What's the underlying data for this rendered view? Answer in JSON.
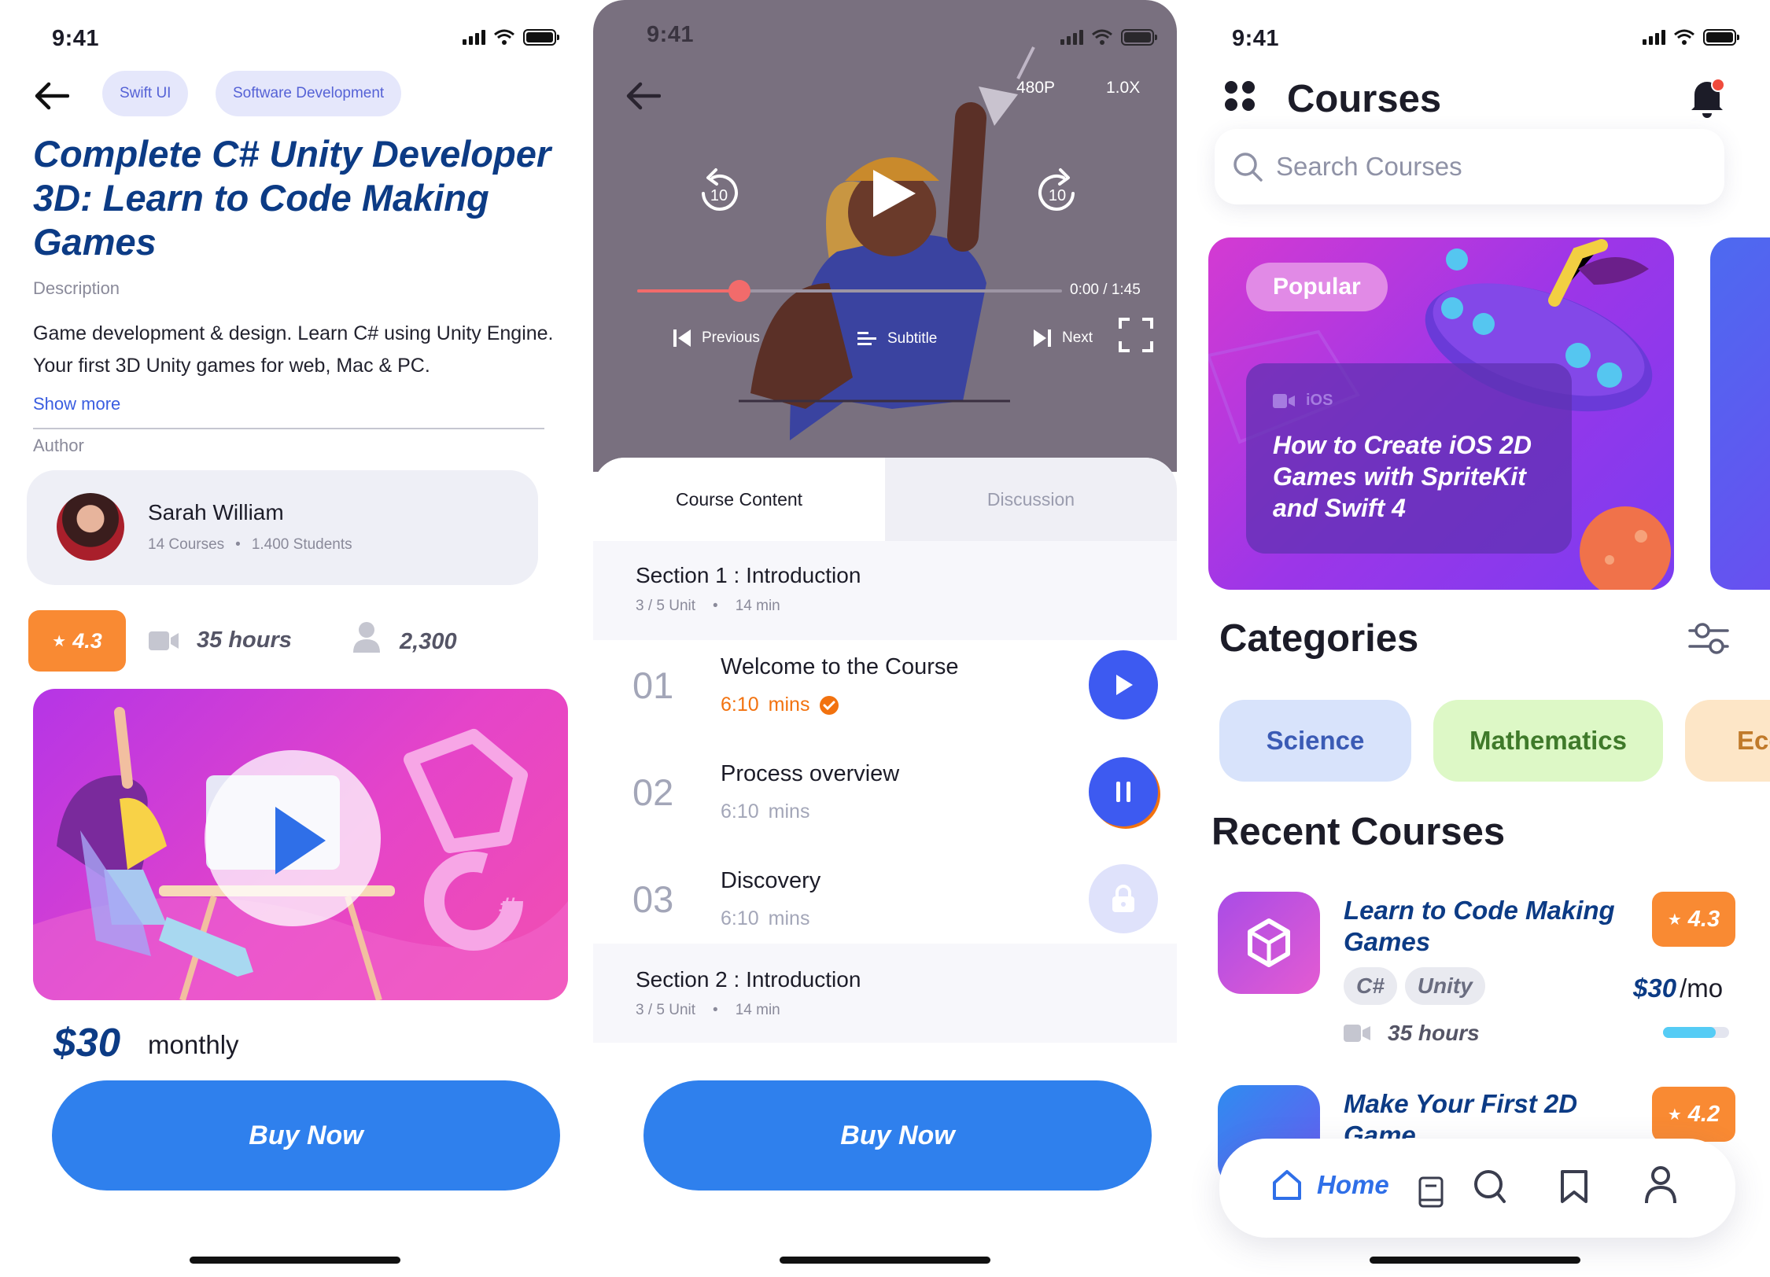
{
  "status": {
    "time": "9:41"
  },
  "detail": {
    "chips": [
      "Swift UI",
      "Software Development"
    ],
    "title": "Complete C# Unity Developer 3D: Learn to Code Making Games",
    "description_label": "Description",
    "description": "Game development & design. Learn C# using Unity Engine. Your first 3D Unity games for web, Mac & PC.",
    "show_more": "Show more",
    "author_label": "Author",
    "author": {
      "name": "Sarah William",
      "courses": "14 Courses",
      "students": "1.400 Students"
    },
    "rating": "4.3",
    "hours": "35 hours",
    "learners": "2,300",
    "price": "$30",
    "price_period": "monthly",
    "buy_label": "Buy Now"
  },
  "player": {
    "quality": "480P",
    "speed": "1.0X",
    "rewind": "10",
    "forward": "10",
    "time": "0:00 / 1:45",
    "progress": 0.24,
    "previous": "Previous",
    "subtitle": "Subtitle",
    "next": "Next",
    "tabs": [
      "Course Content",
      "Discussion"
    ],
    "sections": [
      {
        "title": "Section 1 : Introduction",
        "units": "3 / 5 Unit",
        "duration": "14 min"
      },
      {
        "title": "Section 2 : Introduction",
        "units": "3 / 5 Unit",
        "duration": "14 min"
      }
    ],
    "lessons": [
      {
        "num": "01",
        "title": "Welcome to the Course",
        "time": "6:10",
        "unit": "mins",
        "state": "play"
      },
      {
        "num": "02",
        "title": "Process overview",
        "time": "6:10",
        "unit": "mins",
        "state": "pause"
      },
      {
        "num": "03",
        "title": "Discovery",
        "time": "6:10",
        "unit": "mins",
        "state": "locked"
      }
    ],
    "buy_label": "Buy Now"
  },
  "home": {
    "title": "Courses",
    "search_placeholder": "Search Courses",
    "promo": {
      "badge": "Popular",
      "platform": "iOS",
      "title": "How to Create iOS 2D Games with SpriteKit and Swift 4"
    },
    "categories_title": "Categories",
    "categories": [
      {
        "label": "Science",
        "bg": "#d8e3fb",
        "fg": "#3b5bb5"
      },
      {
        "label": "Mathematics",
        "bg": "#ddf8c6",
        "fg": "#3f7a2a"
      },
      {
        "label": "Eco",
        "bg": "#fde6c7",
        "fg": "#c07a2a"
      }
    ],
    "recent_title": "Recent Courses",
    "recent": [
      {
        "title": "Learn to Code Making Games",
        "tags": [
          "C#",
          "Unity"
        ],
        "rating": "4.3",
        "price": "$30",
        "period": "/mo",
        "hours": "35 hours",
        "progress": 0.8
      },
      {
        "title": "Make Your First 2D Game",
        "rating": "4.2"
      }
    ],
    "nav": {
      "home": "Home"
    }
  },
  "colors": {
    "accent": "#2f80ed",
    "title_blue": "#0c3b85",
    "rating_orange": "#f98a33",
    "play_blue": "#3d5af1",
    "progress_red": "#f26b6b"
  }
}
